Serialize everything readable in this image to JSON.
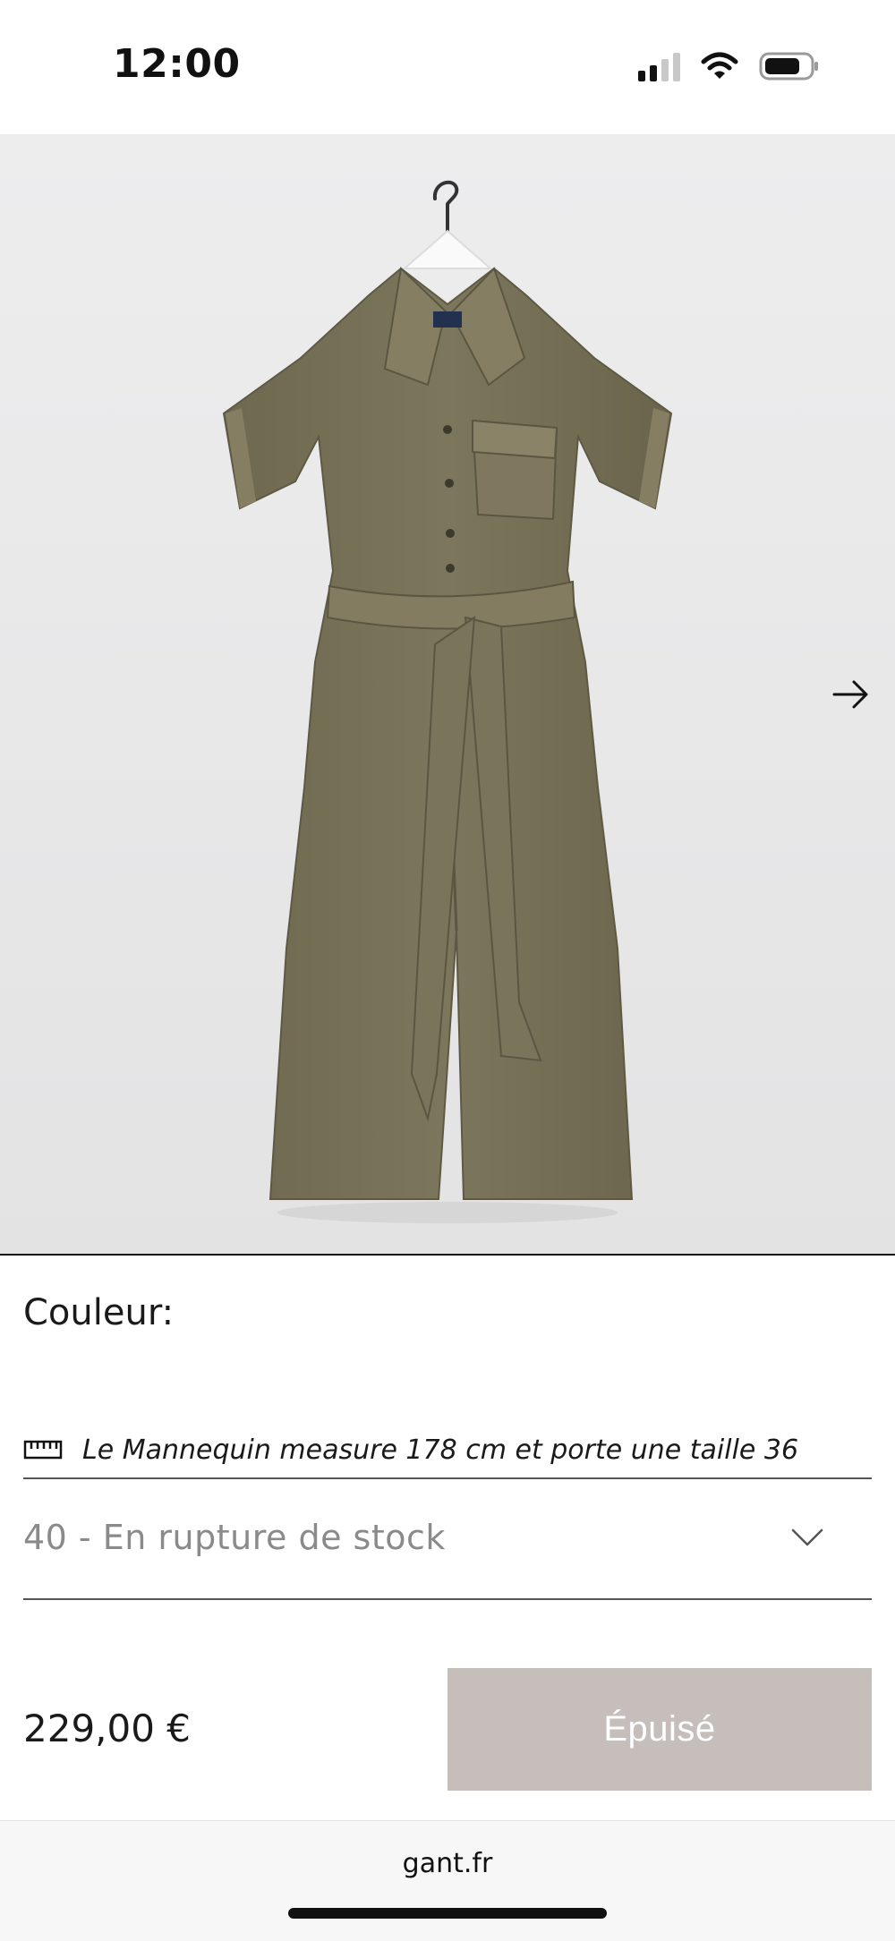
{
  "status_bar": {
    "time": "12:00"
  },
  "product": {
    "color_label": "Couleur:",
    "model_info": "Le Mannequin measure 178 cm et porte une taille 36",
    "size_selected": "40 - En rupture de stock",
    "price": "229,00 €",
    "soldout_label": "Épuisé",
    "garment_color": "#756f56"
  },
  "browser": {
    "url": "gant.fr"
  },
  "icons": {
    "next": "arrow-right-icon",
    "ruler": "ruler-icon",
    "dropdown": "chevron-down-icon"
  }
}
